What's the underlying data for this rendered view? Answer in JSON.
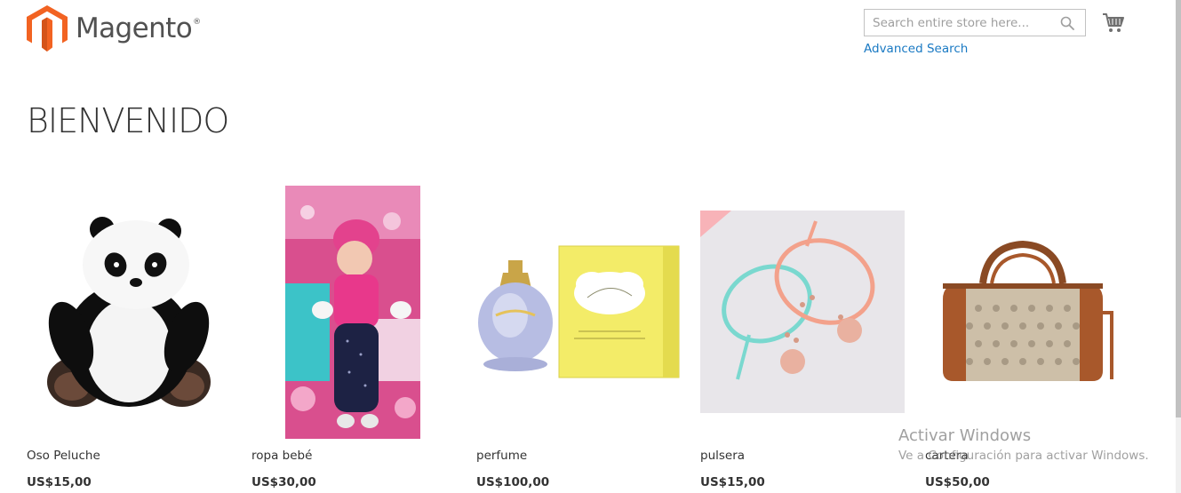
{
  "header": {
    "logo_text": "Magento",
    "logo_mark": "®",
    "search": {
      "placeholder": "Search entire store here...",
      "value": ""
    },
    "advanced_search_label": "Advanced Search"
  },
  "main": {
    "title": "BIENVENIDO",
    "products": [
      {
        "name": "Oso Peluche",
        "price": "US$15,00"
      },
      {
        "name": "ropa bebé",
        "price": "US$30,00"
      },
      {
        "name": "perfume",
        "price": "US$100,00"
      },
      {
        "name": "pulsera",
        "price": "US$15,00"
      },
      {
        "name": "cartera",
        "price": "US$50,00"
      }
    ]
  },
  "watermark": {
    "title": "Activar Windows",
    "subtitle": "Ve a Configuración para activar Windows."
  },
  "colors": {
    "brand_orange": "#f26322",
    "link_blue": "#1979c3",
    "text": "#333333"
  },
  "icons": [
    "magento-logo-icon",
    "search-icon",
    "cart-icon"
  ]
}
